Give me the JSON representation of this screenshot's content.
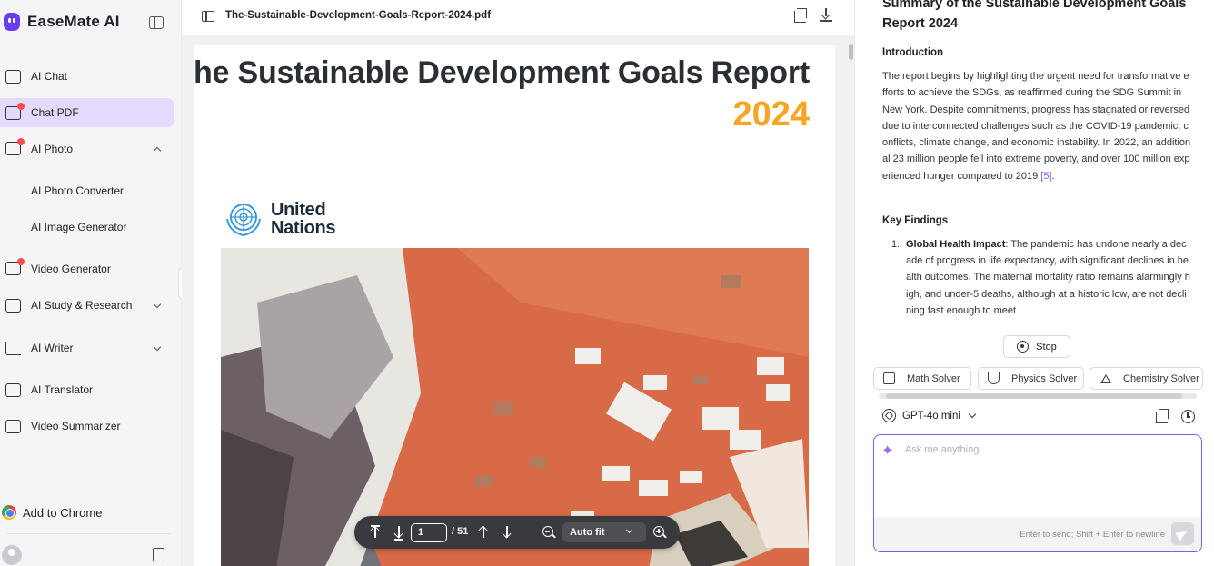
{
  "sidebar": {
    "brand": "EaseMate AI",
    "items": [
      {
        "label": "AI Chat"
      },
      {
        "label": "Chat PDF"
      },
      {
        "label": "AI Photo"
      },
      {
        "label": "AI Photo Converter"
      },
      {
        "label": "AI Image Generator"
      },
      {
        "label": "Video Generator"
      },
      {
        "label": "AI Study & Research"
      },
      {
        "label": "AI Writer"
      },
      {
        "label": "AI Translator"
      },
      {
        "label": "Video Summarizer"
      }
    ],
    "active_item": "Chat PDF",
    "add_to_chrome": "Add to Chrome"
  },
  "pdf": {
    "filename": "The-Sustainable-Development-Goals-Report-2024.pdf",
    "page_title": "The Sustainable Development Goals Report",
    "page_year": "2024",
    "org_line1": "United",
    "org_line2": "Nations",
    "controls": {
      "current_page": "1",
      "total_pages": "/ 51",
      "zoom": "Auto fit"
    }
  },
  "summary": {
    "title": "Summary of the Sustainable Development Goals Report 2024",
    "intro_heading": "Introduction",
    "intro_text": "The report begins by highlighting the urgent need for transformative efforts to achieve the SDGs, as reaffirmed during the SDG Summit in New York. Despite commitments, progress has stagnated or reversed due to interconnected challenges such as the COVID-19 pandemic, conflicts, climate change, and economic instability. In 2022, an additional 23 million people fell into extreme poverty, and over 100 million experienced hunger compared to 2019",
    "intro_cite": "[5]",
    "findings_heading": "Key Findings",
    "finding_1_number": "1.",
    "finding_1_title": "Global Health Impact",
    "finding_1_text": ": The pandemic has undone nearly a decade of progress in life expectancy, with significant declines in health outcomes. The maternal mortality ratio remains alarmingly high, and under-5 deaths, although at a historic low, are not declining fast enough to meet"
  },
  "chat": {
    "stop_label": "Stop",
    "tools": [
      {
        "label": "Math Solver"
      },
      {
        "label": "Physics Solver"
      },
      {
        "label": "Chemistry Solver"
      }
    ],
    "model": "GPT-4o mini",
    "placeholder": "Ask me anything...",
    "hint": "Enter to send; Shift + Enter to newline"
  },
  "colors": {
    "accent": "#8a57e8",
    "active_nav_bg": "#e5dafd",
    "year_orange": "#f6a623"
  }
}
